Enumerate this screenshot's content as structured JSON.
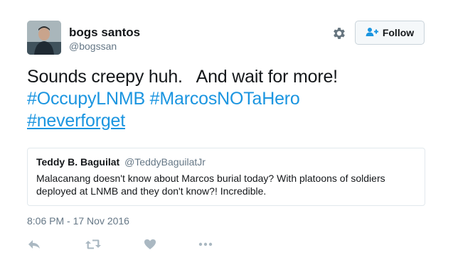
{
  "author": {
    "name": "bogs santos",
    "handle": "@bogssan"
  },
  "header": {
    "follow_label": "Follow"
  },
  "tweet": {
    "line1": "Sounds creepy huh.   And wait for more!",
    "hashtags_line2": [
      "#OccupyLNMB",
      "#MarcosNOTaHero"
    ],
    "hashtag_line3": "#neverforget"
  },
  "quoted": {
    "name": "Teddy B. Baguilat",
    "handle": "@TeddyBaguilatJr",
    "text": "Malacanang doesn't know about Marcos burial today? With platoons of soldiers deployed at LNMB and they don't know?! Incredible."
  },
  "timestamp": "8:06 PM - 17 Nov 2016",
  "colors": {
    "link": "#1b95e0",
    "text": "#14171a",
    "muted": "#657786",
    "icon": "#aab8c2"
  },
  "icons": [
    "gear-icon",
    "add-user-icon",
    "reply-icon",
    "retweet-icon",
    "like-icon",
    "more-icon"
  ]
}
